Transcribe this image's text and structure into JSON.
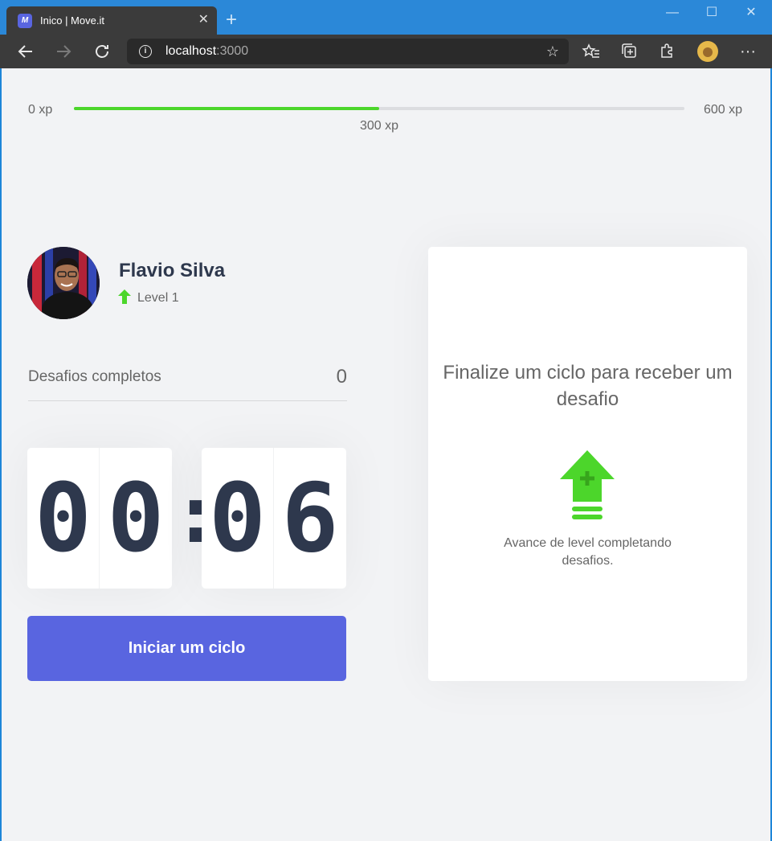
{
  "browser": {
    "tab": {
      "title": "Inico | Move.it",
      "favicon": "move-it-logo",
      "favicon_text": "M"
    },
    "address": {
      "host": "localhost",
      "port": ":3000"
    },
    "icons": [
      "back-icon",
      "forward-icon",
      "reload-icon",
      "info-icon",
      "add-favorite-icon",
      "favorites-icon",
      "collections-icon",
      "extensions-icon",
      "profile-avatar",
      "more-icon"
    ],
    "colors": {
      "titlebar": "#2b88d8",
      "toolbar": "#3b3b3b"
    }
  },
  "experience": {
    "min_label": "0 xp",
    "max_label": "600 xp",
    "current_label": "300 xp",
    "progress_fraction": 0.5
  },
  "profile": {
    "name": "Flavio Silva",
    "level_label": "Level 1",
    "level_icon": "level-up-arrow-icon"
  },
  "challenges": {
    "completed_label": "Desafios completos",
    "completed_count": "0"
  },
  "countdown": {
    "minute_left": "0",
    "minute_right": "0",
    "separator": ":",
    "second_left": "0",
    "second_right": "6"
  },
  "start_button": {
    "label": "Iniciar um ciclo"
  },
  "challenge_card": {
    "title": "Finalize um ciclo para receber um desafio",
    "icon": "level-up-icon",
    "text": "Avance de level completando desafios."
  },
  "colors": {
    "accent_green": "#4cd62b",
    "primary_blue": "#5965e0",
    "title_text": "#2e384d",
    "body_text": "#666666",
    "background": "#f2f3f5"
  }
}
